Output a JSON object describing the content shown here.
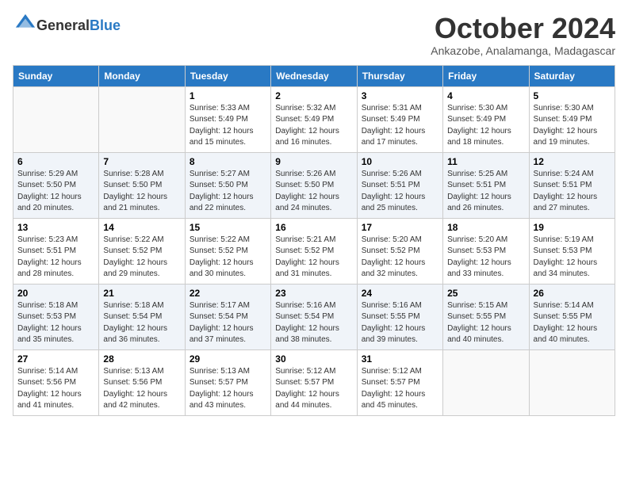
{
  "header": {
    "logo_general": "General",
    "logo_blue": "Blue",
    "month_title": "October 2024",
    "location": "Ankazobe, Analamanga, Madagascar"
  },
  "days_of_week": [
    "Sunday",
    "Monday",
    "Tuesday",
    "Wednesday",
    "Thursday",
    "Friday",
    "Saturday"
  ],
  "weeks": [
    [
      {
        "day": "",
        "sunrise": "",
        "sunset": "",
        "daylight": ""
      },
      {
        "day": "",
        "sunrise": "",
        "sunset": "",
        "daylight": ""
      },
      {
        "day": "1",
        "sunrise": "Sunrise: 5:33 AM",
        "sunset": "Sunset: 5:49 PM",
        "daylight": "Daylight: 12 hours and 15 minutes."
      },
      {
        "day": "2",
        "sunrise": "Sunrise: 5:32 AM",
        "sunset": "Sunset: 5:49 PM",
        "daylight": "Daylight: 12 hours and 16 minutes."
      },
      {
        "day": "3",
        "sunrise": "Sunrise: 5:31 AM",
        "sunset": "Sunset: 5:49 PM",
        "daylight": "Daylight: 12 hours and 17 minutes."
      },
      {
        "day": "4",
        "sunrise": "Sunrise: 5:30 AM",
        "sunset": "Sunset: 5:49 PM",
        "daylight": "Daylight: 12 hours and 18 minutes."
      },
      {
        "day": "5",
        "sunrise": "Sunrise: 5:30 AM",
        "sunset": "Sunset: 5:49 PM",
        "daylight": "Daylight: 12 hours and 19 minutes."
      }
    ],
    [
      {
        "day": "6",
        "sunrise": "Sunrise: 5:29 AM",
        "sunset": "Sunset: 5:50 PM",
        "daylight": "Daylight: 12 hours and 20 minutes."
      },
      {
        "day": "7",
        "sunrise": "Sunrise: 5:28 AM",
        "sunset": "Sunset: 5:50 PM",
        "daylight": "Daylight: 12 hours and 21 minutes."
      },
      {
        "day": "8",
        "sunrise": "Sunrise: 5:27 AM",
        "sunset": "Sunset: 5:50 PM",
        "daylight": "Daylight: 12 hours and 22 minutes."
      },
      {
        "day": "9",
        "sunrise": "Sunrise: 5:26 AM",
        "sunset": "Sunset: 5:50 PM",
        "daylight": "Daylight: 12 hours and 24 minutes."
      },
      {
        "day": "10",
        "sunrise": "Sunrise: 5:26 AM",
        "sunset": "Sunset: 5:51 PM",
        "daylight": "Daylight: 12 hours and 25 minutes."
      },
      {
        "day": "11",
        "sunrise": "Sunrise: 5:25 AM",
        "sunset": "Sunset: 5:51 PM",
        "daylight": "Daylight: 12 hours and 26 minutes."
      },
      {
        "day": "12",
        "sunrise": "Sunrise: 5:24 AM",
        "sunset": "Sunset: 5:51 PM",
        "daylight": "Daylight: 12 hours and 27 minutes."
      }
    ],
    [
      {
        "day": "13",
        "sunrise": "Sunrise: 5:23 AM",
        "sunset": "Sunset: 5:51 PM",
        "daylight": "Daylight: 12 hours and 28 minutes."
      },
      {
        "day": "14",
        "sunrise": "Sunrise: 5:22 AM",
        "sunset": "Sunset: 5:52 PM",
        "daylight": "Daylight: 12 hours and 29 minutes."
      },
      {
        "day": "15",
        "sunrise": "Sunrise: 5:22 AM",
        "sunset": "Sunset: 5:52 PM",
        "daylight": "Daylight: 12 hours and 30 minutes."
      },
      {
        "day": "16",
        "sunrise": "Sunrise: 5:21 AM",
        "sunset": "Sunset: 5:52 PM",
        "daylight": "Daylight: 12 hours and 31 minutes."
      },
      {
        "day": "17",
        "sunrise": "Sunrise: 5:20 AM",
        "sunset": "Sunset: 5:52 PM",
        "daylight": "Daylight: 12 hours and 32 minutes."
      },
      {
        "day": "18",
        "sunrise": "Sunrise: 5:20 AM",
        "sunset": "Sunset: 5:53 PM",
        "daylight": "Daylight: 12 hours and 33 minutes."
      },
      {
        "day": "19",
        "sunrise": "Sunrise: 5:19 AM",
        "sunset": "Sunset: 5:53 PM",
        "daylight": "Daylight: 12 hours and 34 minutes."
      }
    ],
    [
      {
        "day": "20",
        "sunrise": "Sunrise: 5:18 AM",
        "sunset": "Sunset: 5:53 PM",
        "daylight": "Daylight: 12 hours and 35 minutes."
      },
      {
        "day": "21",
        "sunrise": "Sunrise: 5:18 AM",
        "sunset": "Sunset: 5:54 PM",
        "daylight": "Daylight: 12 hours and 36 minutes."
      },
      {
        "day": "22",
        "sunrise": "Sunrise: 5:17 AM",
        "sunset": "Sunset: 5:54 PM",
        "daylight": "Daylight: 12 hours and 37 minutes."
      },
      {
        "day": "23",
        "sunrise": "Sunrise: 5:16 AM",
        "sunset": "Sunset: 5:54 PM",
        "daylight": "Daylight: 12 hours and 38 minutes."
      },
      {
        "day": "24",
        "sunrise": "Sunrise: 5:16 AM",
        "sunset": "Sunset: 5:55 PM",
        "daylight": "Daylight: 12 hours and 39 minutes."
      },
      {
        "day": "25",
        "sunrise": "Sunrise: 5:15 AM",
        "sunset": "Sunset: 5:55 PM",
        "daylight": "Daylight: 12 hours and 40 minutes."
      },
      {
        "day": "26",
        "sunrise": "Sunrise: 5:14 AM",
        "sunset": "Sunset: 5:55 PM",
        "daylight": "Daylight: 12 hours and 40 minutes."
      }
    ],
    [
      {
        "day": "27",
        "sunrise": "Sunrise: 5:14 AM",
        "sunset": "Sunset: 5:56 PM",
        "daylight": "Daylight: 12 hours and 41 minutes."
      },
      {
        "day": "28",
        "sunrise": "Sunrise: 5:13 AM",
        "sunset": "Sunset: 5:56 PM",
        "daylight": "Daylight: 12 hours and 42 minutes."
      },
      {
        "day": "29",
        "sunrise": "Sunrise: 5:13 AM",
        "sunset": "Sunset: 5:57 PM",
        "daylight": "Daylight: 12 hours and 43 minutes."
      },
      {
        "day": "30",
        "sunrise": "Sunrise: 5:12 AM",
        "sunset": "Sunset: 5:57 PM",
        "daylight": "Daylight: 12 hours and 44 minutes."
      },
      {
        "day": "31",
        "sunrise": "Sunrise: 5:12 AM",
        "sunset": "Sunset: 5:57 PM",
        "daylight": "Daylight: 12 hours and 45 minutes."
      },
      {
        "day": "",
        "sunrise": "",
        "sunset": "",
        "daylight": ""
      },
      {
        "day": "",
        "sunrise": "",
        "sunset": "",
        "daylight": ""
      }
    ]
  ]
}
